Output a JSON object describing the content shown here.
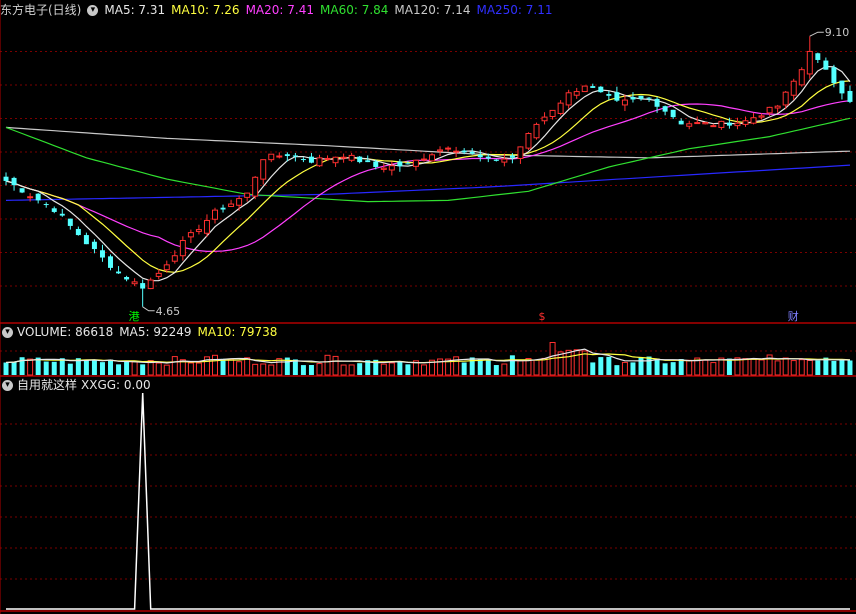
{
  "main_header": {
    "title": "东方电子(日线)",
    "ma5": "MA5: 7.31",
    "ma10": "MA10: 7.26",
    "ma20": "MA20: 7.41",
    "ma60": "MA60: 7.84",
    "ma120": "MA120: 7.14",
    "ma250": "MA250: 7.11"
  },
  "volume_header": {
    "volume": "VOLUME: 86618",
    "ma5": "MA5: 92249",
    "ma10": "MA10: 79738"
  },
  "indicator_header": {
    "name": "自用就这样",
    "xxgg": "XXGG: 0.00"
  },
  "icons": {
    "header_toggle": "chevron-down-icon"
  },
  "colors": {
    "up": "#ff3030",
    "down": "#54ffff",
    "ma5": "#e6e6e6",
    "ma10": "#ffff40",
    "ma20": "#ff40ff",
    "ma60": "#30e030",
    "ma120": "#c8c8c8",
    "ma250": "#2828ff",
    "grid": "#7a0000",
    "indicator": "#ffffff"
  },
  "markers": [
    {
      "text": "港",
      "color": "#00ff00",
      "index": 16
    },
    {
      "text": "$",
      "color": "#ff3030",
      "index": 67
    },
    {
      "text": "财",
      "color": "#8080ff",
      "index": 98
    }
  ],
  "chart_data": {
    "type": "candlestick",
    "annotations": {
      "high_label": "9.10",
      "low_label": "4.65",
      "high_value": 9.1,
      "low_value": 4.65
    },
    "price_range": [
      4.4,
      9.4
    ],
    "volume_range": [
      0,
      160000
    ],
    "indicator_range": [
      0,
      1
    ],
    "indicator_spike_index": 17,
    "ohlc": [],
    "volume": [],
    "ma5": [],
    "ma10": [],
    "ma20": [],
    "ma60": [],
    "ma120": [],
    "ma250": [],
    "volume_ma5": [],
    "volume_ma10": [],
    "xxgg": []
  }
}
